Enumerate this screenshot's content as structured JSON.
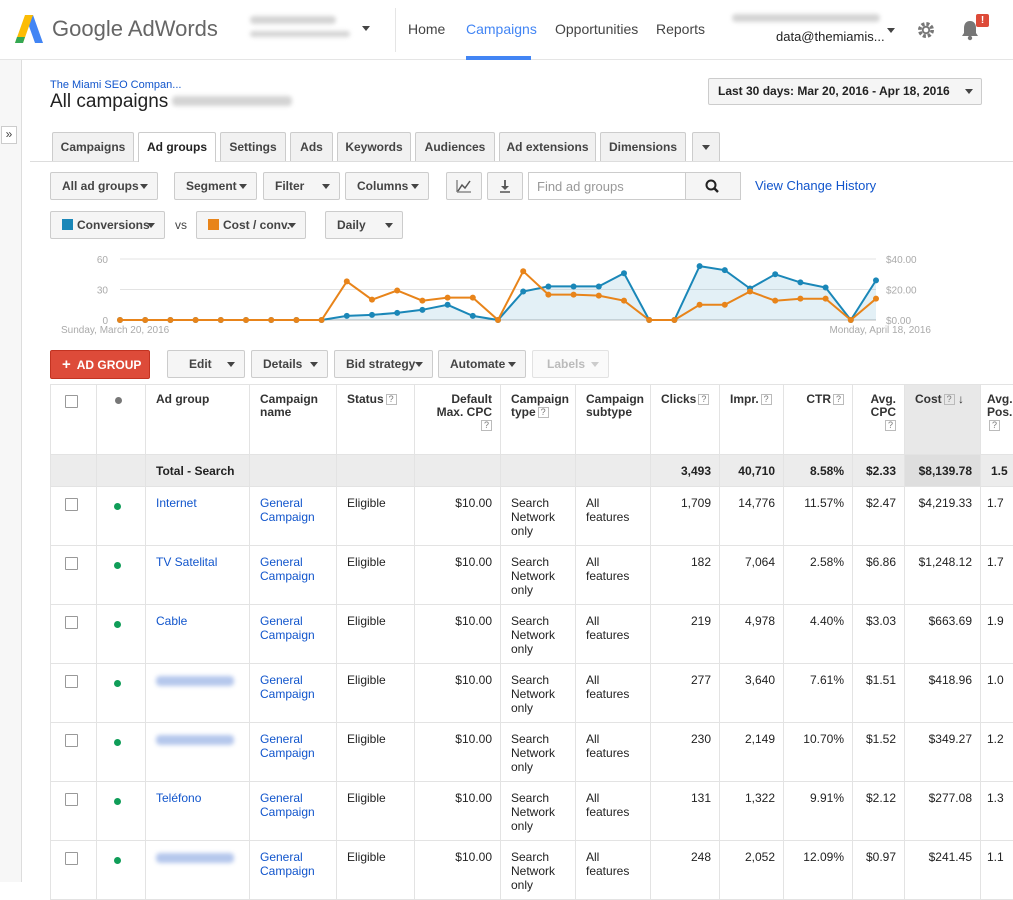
{
  "header": {
    "product_name": "Google AdWords",
    "nav": [
      "Home",
      "Campaigns",
      "Opportunities",
      "Reports"
    ],
    "active_nav": "Campaigns",
    "account_email": "data@themiamis...",
    "notification_badge": "!",
    "icons": [
      "adwords-logo-icon",
      "gear-icon",
      "bell-icon",
      "chevron-down-icon"
    ]
  },
  "page": {
    "breadcrumb": "The Miami SEO Compan...",
    "title": "All campaigns",
    "date_range": "Last 30 days: Mar 20, 2016 - Apr 18, 2016"
  },
  "tabs": [
    "Campaigns",
    "Ad groups",
    "Settings",
    "Ads",
    "Keywords",
    "Audiences",
    "Ad extensions",
    "Dimensions"
  ],
  "active_tab": "Ad groups",
  "toolbar": {
    "filter_scope": "All ad groups",
    "segment": "Segment",
    "filter": "Filter",
    "columns": "Columns",
    "search_placeholder": "Find ad groups",
    "history_link": "View Change History"
  },
  "chart_controls": {
    "metric1": "Conversions",
    "vs": "vs",
    "metric2": "Cost / conv.",
    "granularity": "Daily",
    "metric1_color": "#1a87b8",
    "metric2_color": "#e8841a"
  },
  "chart_data": {
    "type": "line",
    "x_start_label": "Sunday, March 20, 2016",
    "x_end_label": "Monday, April 18, 2016",
    "left_ticks": [
      "60",
      "30",
      "0"
    ],
    "right_ticks": [
      "$40.00",
      "$20.00",
      "$0.00"
    ],
    "ylim_left": [
      0,
      60
    ],
    "ylim_right": [
      0,
      40
    ],
    "series": [
      {
        "name": "Conversions",
        "axis": "left",
        "color": "#1a87b8",
        "values": [
          0,
          0,
          0,
          0,
          0,
          0,
          0,
          0,
          0,
          4,
          5,
          7,
          10,
          15,
          4,
          0,
          28,
          33,
          33,
          33,
          46,
          0,
          0,
          53,
          49,
          31,
          45,
          37,
          32,
          0,
          39
        ]
      },
      {
        "name": "Cost / conv.",
        "axis": "left",
        "color": "#e8841a",
        "values": [
          0,
          0,
          0,
          0,
          0,
          0,
          0,
          0,
          0,
          38,
          20,
          29,
          19,
          22,
          22,
          0,
          48,
          25,
          25,
          24,
          19,
          0,
          0,
          15,
          15,
          28,
          19,
          21,
          21,
          0,
          21
        ]
      }
    ]
  },
  "actions": {
    "add": "AD GROUP",
    "edit": "Edit",
    "details": "Details",
    "bid_strategy": "Bid strategy",
    "automate": "Automate",
    "labels": "Labels"
  },
  "table": {
    "columns": [
      "Ad group",
      "Campaign name",
      "Status",
      "Default Max. CPC",
      "Campaign type",
      "Campaign subtype",
      "Clicks",
      "Impr.",
      "CTR",
      "Avg. CPC",
      "Cost",
      "Avg. Pos."
    ],
    "total": {
      "label": "Total - Search",
      "clicks": "3,493",
      "impr": "40,710",
      "ctr": "8.58%",
      "avg_cpc": "$2.33",
      "cost": "$8,139.78",
      "avg_pos": "1.5"
    },
    "rows": [
      {
        "ad_group": "Internet",
        "campaign": "General Campaign",
        "status": "Eligible",
        "max_cpc": "$10.00",
        "type": "Search Network only",
        "subtype": "All features",
        "clicks": "1,709",
        "impr": "14,776",
        "ctr": "11.57%",
        "avg_cpc": "$2.47",
        "cost": "$4,219.33",
        "avg_pos": "1.7"
      },
      {
        "ad_group": "TV Satelital",
        "campaign": "General Campaign",
        "status": "Eligible",
        "max_cpc": "$10.00",
        "type": "Search Network only",
        "subtype": "All features",
        "clicks": "182",
        "impr": "7,064",
        "ctr": "2.58%",
        "avg_cpc": "$6.86",
        "cost": "$1,248.12",
        "avg_pos": "1.7"
      },
      {
        "ad_group": "Cable",
        "campaign": "General Campaign",
        "status": "Eligible",
        "max_cpc": "$10.00",
        "type": "Search Network only",
        "subtype": "All features",
        "clicks": "219",
        "impr": "4,978",
        "ctr": "4.40%",
        "avg_cpc": "$3.03",
        "cost": "$663.69",
        "avg_pos": "1.9"
      },
      {
        "ad_group": "",
        "campaign": "General Campaign",
        "status": "Eligible",
        "max_cpc": "$10.00",
        "type": "Search Network only",
        "subtype": "All features",
        "clicks": "277",
        "impr": "3,640",
        "ctr": "7.61%",
        "avg_cpc": "$1.51",
        "cost": "$418.96",
        "avg_pos": "1.0"
      },
      {
        "ad_group": "",
        "campaign": "General Campaign",
        "status": "Eligible",
        "max_cpc": "$10.00",
        "type": "Search Network only",
        "subtype": "All features",
        "clicks": "230",
        "impr": "2,149",
        "ctr": "10.70%",
        "avg_cpc": "$1.52",
        "cost": "$349.27",
        "avg_pos": "1.2"
      },
      {
        "ad_group": "Teléfono",
        "campaign": "General Campaign",
        "status": "Eligible",
        "max_cpc": "$10.00",
        "type": "Search Network only",
        "subtype": "All features",
        "clicks": "131",
        "impr": "1,322",
        "ctr": "9.91%",
        "avg_cpc": "$2.12",
        "cost": "$277.08",
        "avg_pos": "1.3"
      },
      {
        "ad_group": "",
        "campaign": "General Campaign",
        "status": "Eligible",
        "max_cpc": "$10.00",
        "type": "Search Network only",
        "subtype": "All features",
        "clicks": "248",
        "impr": "2,052",
        "ctr": "12.09%",
        "avg_cpc": "$0.97",
        "cost": "$241.45",
        "avg_pos": "1.1"
      }
    ]
  }
}
